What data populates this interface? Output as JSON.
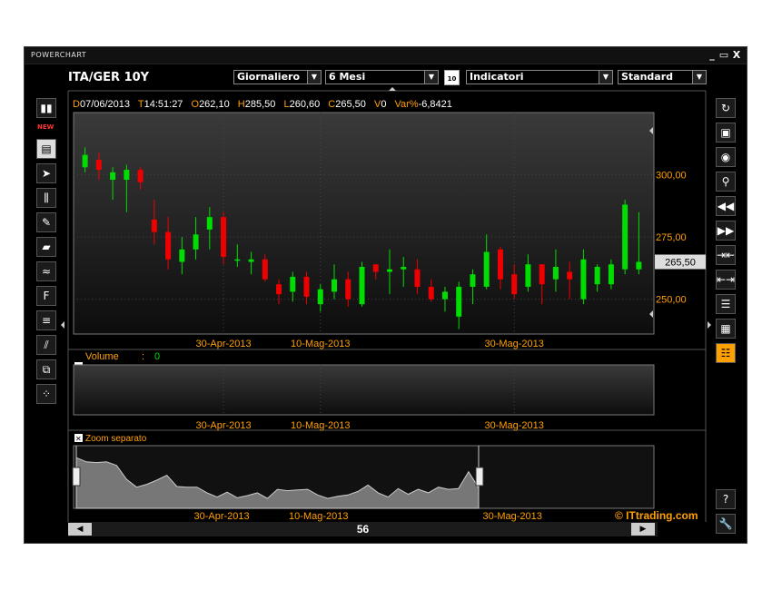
{
  "window": {
    "app_title": "POWERCHART",
    "minimize": "_",
    "maximize": "▭",
    "close": "X"
  },
  "toolbar": {
    "symbol": "ITA/GER 10Y",
    "interval": "Giornaliero",
    "period": "6 Mesi",
    "calendar_icon": "10",
    "indicators": "Indicatori",
    "layout": "Standard"
  },
  "new_tag": "NEW",
  "ohlc": {
    "d_label": "D",
    "date": "07/06/2013",
    "t_label": "T",
    "time": "14:51:27",
    "o_label": "O",
    "open": "262,10",
    "h_label": "H",
    "high": "285,50",
    "l_label": "L",
    "low": "260,60",
    "c_label": "C",
    "close": "265,50",
    "v_label": "V",
    "volume": "0",
    "var_label": "Var%",
    "var": "-6,8421"
  },
  "colors": {
    "up": "#00dd00",
    "down": "#ee0000",
    "label": "#ffa000",
    "grid": "#444444"
  },
  "volume_panel": {
    "label": "Volume",
    "sep": ":",
    "value": "0"
  },
  "zoom_panel": {
    "label": "Zoom separato"
  },
  "copyright": "© ITtrading.com",
  "scroll": {
    "value": "56"
  },
  "left_tools": [
    "panels-icon",
    "chart-type-icon",
    "cursor-icon",
    "studies-icon",
    "pencil-icon",
    "eraser-icon",
    "trendline-icon",
    "fibonacci-icon",
    "gann-icon",
    "pitchfork-icon",
    "objects-icon",
    "grid-icon"
  ],
  "right_tools": [
    "refresh-icon",
    "save-icon",
    "camera-icon",
    "zoom-icon",
    "rewind-icon",
    "forward-icon",
    "compress-icon",
    "expand-icon",
    "list-icon",
    "table-icon",
    "notes-icon",
    "help-icon",
    "wrench-icon"
  ],
  "chart_data": [
    {
      "type": "candlestick",
      "y_ticks": [
        "300,00",
        "275,00",
        "250,00"
      ],
      "ylim": [
        236,
        325
      ],
      "x_ticks": [
        "30-Apr-2013",
        "10-Mag-2013",
        "30-Mag-2013"
      ],
      "last_price_label": "265,50",
      "candles": [
        {
          "o": 303,
          "h": 311,
          "l": 301,
          "c": 308
        },
        {
          "o": 306,
          "h": 309,
          "l": 298,
          "c": 302
        },
        {
          "o": 298,
          "h": 303,
          "l": 290,
          "c": 301
        },
        {
          "o": 298,
          "h": 304,
          "l": 285,
          "c": 302
        },
        {
          "o": 302,
          "h": 303,
          "l": 294,
          "c": 297
        },
        {
          "o": 282,
          "h": 290,
          "l": 272,
          "c": 277
        },
        {
          "o": 277,
          "h": 283,
          "l": 262,
          "c": 266
        },
        {
          "o": 265,
          "h": 275,
          "l": 260,
          "c": 270
        },
        {
          "o": 270,
          "h": 283,
          "l": 266,
          "c": 276
        },
        {
          "o": 278,
          "h": 287,
          "l": 270,
          "c": 283
        },
        {
          "o": 283,
          "h": 285,
          "l": 264,
          "c": 267
        },
        {
          "o": 266,
          "h": 272,
          "l": 263,
          "c": 266
        },
        {
          "o": 265,
          "h": 269,
          "l": 260,
          "c": 266
        },
        {
          "o": 266,
          "h": 268,
          "l": 257,
          "c": 258
        },
        {
          "o": 256,
          "h": 258,
          "l": 248,
          "c": 252
        },
        {
          "o": 253,
          "h": 261,
          "l": 249,
          "c": 259
        },
        {
          "o": 259,
          "h": 261,
          "l": 248,
          "c": 251
        },
        {
          "o": 248,
          "h": 256,
          "l": 245,
          "c": 254
        },
        {
          "o": 253,
          "h": 264,
          "l": 250,
          "c": 258
        },
        {
          "o": 258,
          "h": 261,
          "l": 247,
          "c": 250
        },
        {
          "o": 248,
          "h": 265,
          "l": 247,
          "c": 263
        },
        {
          "o": 264,
          "h": 264,
          "l": 258,
          "c": 261
        },
        {
          "o": 261,
          "h": 270,
          "l": 252,
          "c": 262
        },
        {
          "o": 262,
          "h": 267,
          "l": 255,
          "c": 263
        },
        {
          "o": 262,
          "h": 266,
          "l": 252,
          "c": 255
        },
        {
          "o": 255,
          "h": 258,
          "l": 249,
          "c": 250
        },
        {
          "o": 250,
          "h": 255,
          "l": 245,
          "c": 253
        },
        {
          "o": 243,
          "h": 257,
          "l": 238,
          "c": 255
        },
        {
          "o": 255,
          "h": 262,
          "l": 248,
          "c": 260
        },
        {
          "o": 255,
          "h": 276,
          "l": 254,
          "c": 269
        },
        {
          "o": 270,
          "h": 271,
          "l": 254,
          "c": 258
        },
        {
          "o": 260,
          "h": 264,
          "l": 250,
          "c": 252
        },
        {
          "o": 255,
          "h": 268,
          "l": 253,
          "c": 264
        },
        {
          "o": 264,
          "h": 264,
          "l": 248,
          "c": 256
        },
        {
          "o": 258,
          "h": 270,
          "l": 253,
          "c": 263
        },
        {
          "o": 261,
          "h": 265,
          "l": 250,
          "c": 258
        },
        {
          "o": 250,
          "h": 270,
          "l": 248,
          "c": 266
        },
        {
          "o": 256,
          "h": 264,
          "l": 253,
          "c": 263
        },
        {
          "o": 256,
          "h": 266,
          "l": 254,
          "c": 264
        },
        {
          "o": 262,
          "h": 290,
          "l": 260,
          "c": 288
        },
        {
          "o": 262,
          "h": 285,
          "l": 260,
          "c": 265
        }
      ]
    },
    {
      "type": "area",
      "title": "Zoom separato",
      "ylim": [
        236,
        325
      ],
      "x_ticks": [
        "30-Apr-2013",
        "10-Mag-2013",
        "30-Mag-2013"
      ],
      "values": [
        308,
        302,
        301,
        302,
        297,
        277,
        266,
        270,
        276,
        283,
        267,
        266,
        266,
        258,
        252,
        259,
        251,
        254,
        258,
        250,
        263,
        261,
        262,
        263,
        255,
        250,
        253,
        255,
        260,
        269,
        258,
        252,
        264,
        256,
        263,
        258,
        266,
        263,
        264,
        288,
        265
      ]
    }
  ]
}
